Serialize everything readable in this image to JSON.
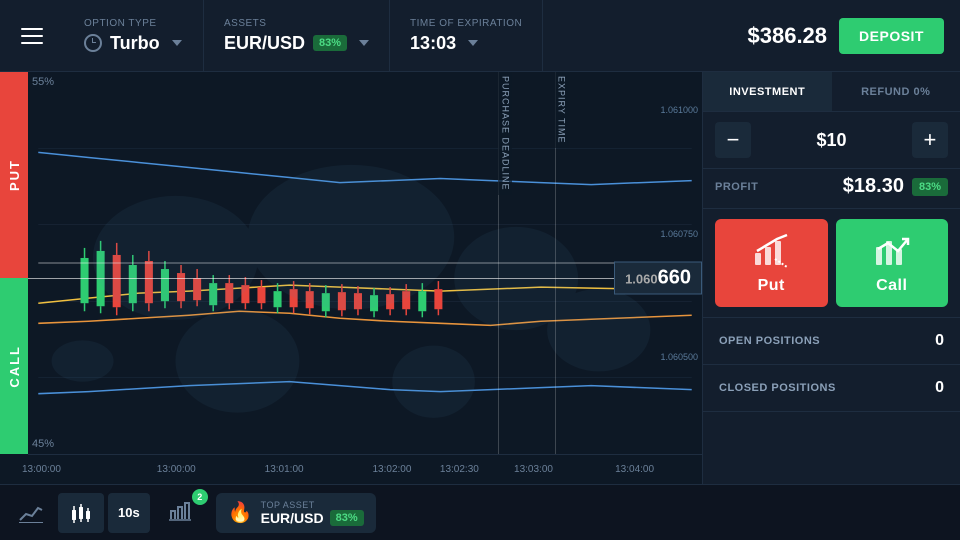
{
  "topbar": {
    "menu_label": "Menu",
    "option_type": {
      "label": "OPTION TYPE",
      "value": "Turbo"
    },
    "assets": {
      "label": "ASSETS",
      "value": "EUR/USD",
      "badge": "83%"
    },
    "expiration": {
      "label": "TIME OF EXPIRATION",
      "value": "13:03"
    },
    "balance": "$386.28",
    "deposit_label": "DEPOSIT"
  },
  "chart": {
    "put_label": "PUT",
    "call_label": "CALL",
    "pct_top": "55%",
    "pct_bottom": "45%",
    "price_display": "1.060",
    "price_big": "660",
    "deadline_label": "PURCHASE DEADLINE",
    "expiry_label": "EXPIRY TIME",
    "y_labels": [
      "1.061000",
      "1.060750",
      "1.060500"
    ],
    "time_ticks": [
      "13:00:00",
      "13:01:00",
      "13:02:00",
      "13:02:30",
      "13:03:00",
      "13:04:00"
    ]
  },
  "panel": {
    "investment_tab": "INVESTMENT",
    "refund_tab": "REFUND 0%",
    "minus_label": "−",
    "amount": "$10",
    "plus_label": "+",
    "profit_label": "PROFIT",
    "profit_amount": "$18.30",
    "profit_pct": "83%",
    "put_label": "Put",
    "call_label": "Call",
    "open_positions_label": "OPEN POSITIONS",
    "open_positions_count": "0",
    "closed_positions_label": "CLOSED POSITIONS",
    "closed_positions_count": "0"
  },
  "bottombar": {
    "timeframe": "10s",
    "top_asset_label": "TOP ASSET",
    "top_asset_value": "EUR/USD",
    "top_asset_badge": "83%",
    "signal_badge": "2"
  }
}
